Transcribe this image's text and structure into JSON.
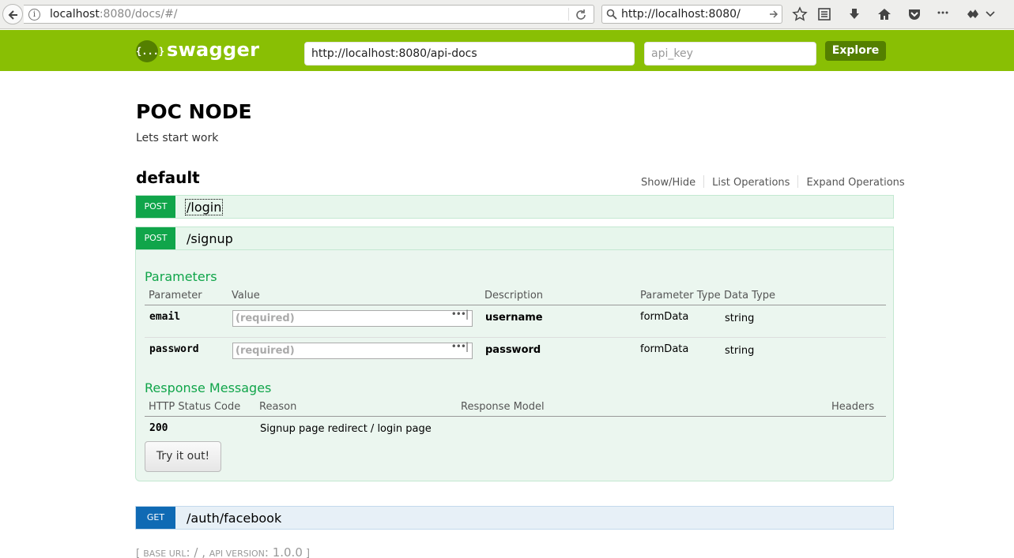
{
  "browser": {
    "url_host": "localhost",
    "url_rest": ":8080/docs/#/",
    "search_text": "http://localhost:8080/"
  },
  "header": {
    "logo_text": "{...}",
    "title": "swagger",
    "api_url": "http://localhost:8080/api-docs",
    "api_key_placeholder": "api_key",
    "explore_label": "Explore",
    "accent_color": "#89bf04"
  },
  "info": {
    "title": "POC NODE",
    "description": "Lets start work"
  },
  "resource": {
    "name": "default",
    "ops": [
      "Show/Hide",
      "List Operations",
      "Expand Operations"
    ]
  },
  "operations": [
    {
      "method": "POST",
      "path": "/login"
    },
    {
      "method": "POST",
      "path": "/signup"
    },
    {
      "method": "GET",
      "path": "/auth/facebook"
    }
  ],
  "signup": {
    "parameters_title": "Parameters",
    "param_headers": [
      "Parameter",
      "Value",
      "Description",
      "Parameter Type",
      "Data Type"
    ],
    "params": [
      {
        "name": "email",
        "placeholder": "(required)",
        "description": "username",
        "param_type": "formData",
        "data_type": "string"
      },
      {
        "name": "password",
        "placeholder": "(required)",
        "description": "password",
        "param_type": "formData",
        "data_type": "string"
      }
    ],
    "responses_title": "Response Messages",
    "response_headers": [
      "HTTP Status Code",
      "Reason",
      "Response Model",
      "Headers"
    ],
    "responses": [
      {
        "code": "200",
        "reason": "Signup page redirect / login page"
      }
    ],
    "try_label": "Try it out!"
  },
  "footer": {
    "open": "[ ",
    "base_url_label": "BASE URL",
    "base_url_value": ": / , ",
    "api_version_label": "API VERSION",
    "api_version_value": ": 1.0.0",
    "close": " ]"
  }
}
